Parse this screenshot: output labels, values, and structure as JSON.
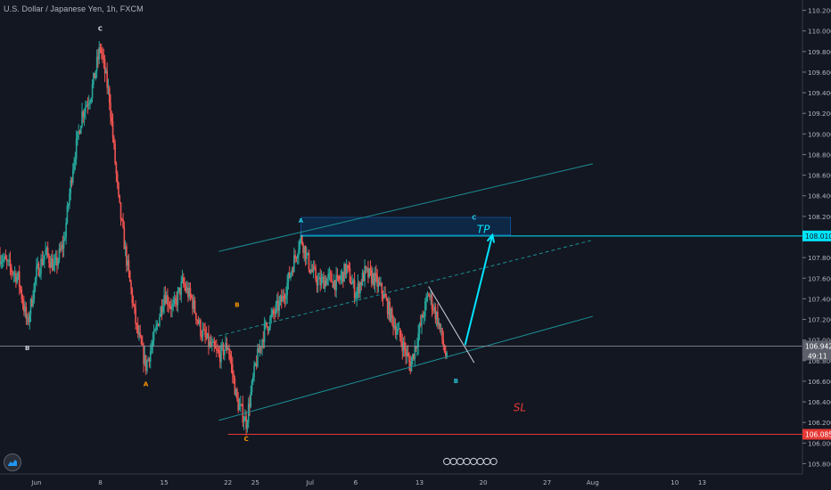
{
  "header": {
    "title": "U.S. Dollar / Japanese Yen, 1h, FXCM"
  },
  "colors": {
    "background": "#131722",
    "up": "#26a69a",
    "down": "#ef5350",
    "cyan": "#00e5ff",
    "channel": "#1b8f93",
    "tp_zone": "#0d2a4a",
    "sl_line": "#e53935",
    "axis_text": "#b2b5be",
    "price_line": "#9598a1"
  },
  "chart_data": {
    "type": "candlestick",
    "title": "U.S. Dollar / Japanese Yen, 1h, FXCM",
    "ylim": [
      105.7,
      110.3
    ],
    "yticks": [
      105.8,
      106.0,
      106.2,
      106.4,
      106.6,
      106.8,
      107.0,
      107.2,
      107.4,
      107.6,
      107.8,
      108.0,
      108.2,
      108.4,
      108.6,
      108.8,
      109.0,
      109.2,
      109.4,
      109.6,
      109.8,
      110.0,
      110.2
    ],
    "x_domain": [
      "2019-05-28",
      "2019-08-24"
    ],
    "xticks": [
      {
        "date": "2019-06-01",
        "label": "Jun"
      },
      {
        "date": "2019-06-08",
        "label": "8"
      },
      {
        "date": "2019-06-15",
        "label": "15"
      },
      {
        "date": "2019-06-22",
        "label": "22"
      },
      {
        "date": "2019-06-25",
        "label": "25"
      },
      {
        "date": "2019-07-01",
        "label": "Jul"
      },
      {
        "date": "2019-07-06",
        "label": "6"
      },
      {
        "date": "2019-07-13",
        "label": "13"
      },
      {
        "date": "2019-07-20",
        "label": "20"
      },
      {
        "date": "2019-07-27",
        "label": "27"
      },
      {
        "date": "2019-08-01",
        "label": "Aug"
      },
      {
        "date": "2019-08-10",
        "label": "10"
      },
      {
        "date": "2019-08-13",
        "label": "13"
      }
    ],
    "price_path": [
      [
        "2019-05-28",
        107.82
      ],
      [
        "2019-05-30",
        107.6
      ],
      [
        "2019-05-31",
        107.15
      ],
      [
        "2019-06-01",
        107.65
      ],
      [
        "2019-06-02",
        107.85
      ],
      [
        "2019-06-03",
        107.7
      ],
      [
        "2019-06-04",
        107.95
      ],
      [
        "2019-06-05",
        108.7
      ],
      [
        "2019-06-06",
        109.2
      ],
      [
        "2019-06-07",
        109.4
      ],
      [
        "2019-06-08",
        109.85
      ],
      [
        "2019-06-09",
        109.35
      ],
      [
        "2019-06-10",
        108.35
      ],
      [
        "2019-06-11",
        107.7
      ],
      [
        "2019-06-12",
        107.1
      ],
      [
        "2019-06-13",
        106.75
      ],
      [
        "2019-06-14",
        107.05
      ],
      [
        "2019-06-15",
        107.45
      ],
      [
        "2019-06-16",
        107.3
      ],
      [
        "2019-06-17",
        107.55
      ],
      [
        "2019-06-18",
        107.4
      ],
      [
        "2019-06-19",
        107.1
      ],
      [
        "2019-06-20",
        106.95
      ],
      [
        "2019-06-21",
        106.85
      ],
      [
        "2019-06-22",
        106.95
      ],
      [
        "2019-06-23",
        106.4
      ],
      [
        "2019-06-24",
        106.2
      ],
      [
        "2019-06-25",
        106.75
      ],
      [
        "2019-06-26",
        107.1
      ],
      [
        "2019-06-27",
        107.25
      ],
      [
        "2019-06-28",
        107.4
      ],
      [
        "2019-06-30",
        108.0
      ],
      [
        "2019-07-01",
        107.7
      ],
      [
        "2019-07-02",
        107.55
      ],
      [
        "2019-07-03",
        107.6
      ],
      [
        "2019-07-04",
        107.55
      ],
      [
        "2019-07-05",
        107.7
      ],
      [
        "2019-07-06",
        107.45
      ],
      [
        "2019-07-07",
        107.65
      ],
      [
        "2019-07-08",
        107.6
      ],
      [
        "2019-07-09",
        107.45
      ],
      [
        "2019-07-10",
        107.2
      ],
      [
        "2019-07-11",
        107.0
      ],
      [
        "2019-07-12",
        106.75
      ],
      [
        "2019-07-13",
        107.1
      ],
      [
        "2019-07-14",
        107.45
      ],
      [
        "2019-07-15",
        107.2
      ],
      [
        "2019-07-16",
        106.8
      ]
    ],
    "current_price": {
      "value": 106.942,
      "label": "106.942",
      "countdown": "49:11"
    },
    "tp_line": {
      "value": 108.01,
      "label": "108.010"
    },
    "sl_line": {
      "value": 106.085,
      "label": "106.085"
    },
    "tp_zone": {
      "x_start": "2019-06-30",
      "x_end": "2019-07-23",
      "y_low": 108.02,
      "y_high": 108.19
    },
    "channel": {
      "upper": [
        [
          "2019-06-21",
          107.86
        ],
        [
          "2019-08-01",
          108.71
        ]
      ],
      "middle": [
        [
          "2019-06-21",
          107.04
        ],
        [
          "2019-08-01",
          107.97
        ]
      ],
      "lower": [
        [
          "2019-06-21",
          106.22
        ],
        [
          "2019-08-01",
          107.23
        ]
      ]
    },
    "projection": [
      [
        "2019-07-18",
        106.95
      ],
      [
        "2019-07-21",
        108.02
      ]
    ],
    "trendline": [
      [
        "2019-07-14",
        107.52
      ],
      [
        "2019-07-19",
        106.78
      ]
    ],
    "wave_labels": [
      {
        "text": "C",
        "x": "2019-06-08",
        "y": 110.0,
        "color": "#d1d4dc"
      },
      {
        "text": "B",
        "x": "2019-05-31",
        "y": 106.9,
        "color": "#d1d4dc"
      },
      {
        "text": "A",
        "x": "2019-06-13",
        "y": 106.55,
        "color": "#ff9800"
      },
      {
        "text": "B",
        "x": "2019-06-23",
        "y": 107.32,
        "color": "#ff9800"
      },
      {
        "text": "C",
        "x": "2019-06-24",
        "y": 106.02,
        "color": "#ff9800"
      },
      {
        "text": "A",
        "x": "2019-06-30",
        "y": 108.14,
        "color": "#26c6da"
      },
      {
        "text": "B",
        "x": "2019-07-17",
        "y": 106.58,
        "color": "#26c6da"
      },
      {
        "text": "C",
        "x": "2019-07-19",
        "y": 108.17,
        "color": "#26c6da"
      }
    ],
    "annotations": [
      {
        "text": "TP",
        "x": "2019-07-20",
        "y": 108.04,
        "color": "#00e5ff"
      },
      {
        "text": "SL",
        "x": "2019-07-24",
        "y": 106.31,
        "color": "#e53935"
      }
    ]
  }
}
